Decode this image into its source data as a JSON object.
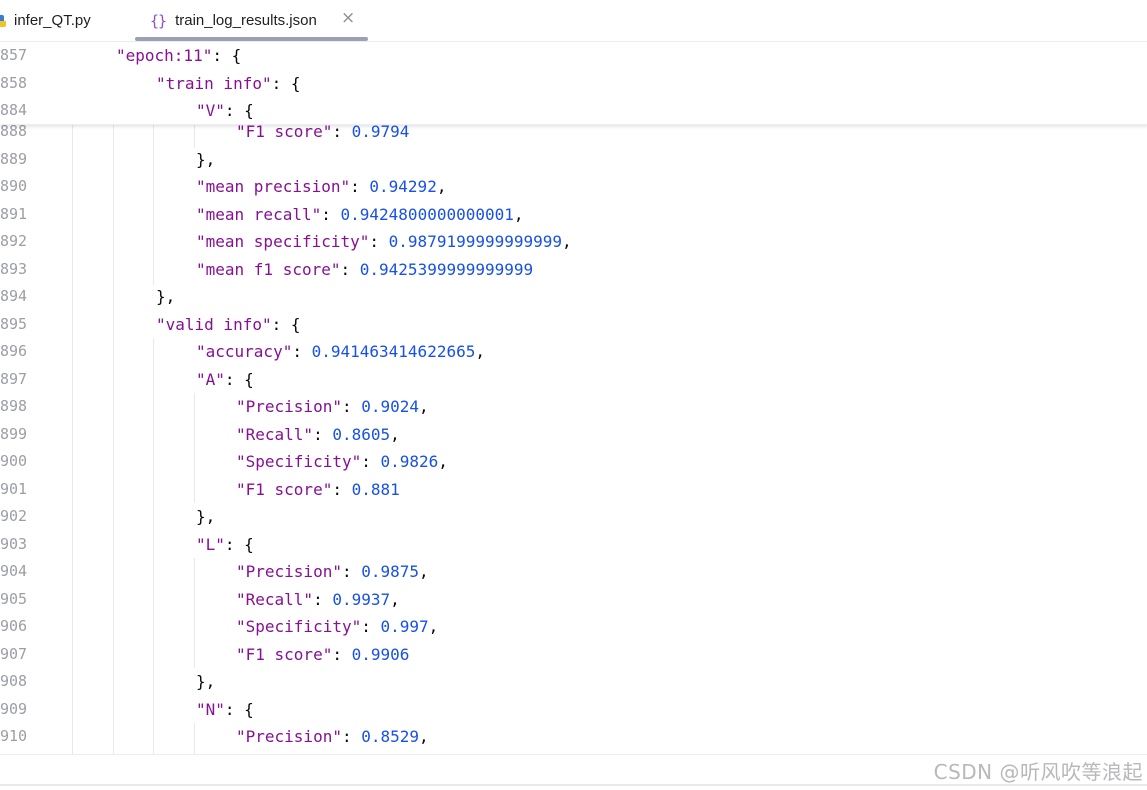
{
  "tabs": [
    {
      "label": "infer_QT.py",
      "icon": "python-file-icon",
      "active": false
    },
    {
      "label": "train_log_results.json",
      "icon": "json-file-icon",
      "glyph": "{}",
      "active": true
    }
  ],
  "close_glyph": "×",
  "sticky_lines": [
    {
      "num": "857",
      "indent": 1,
      "tokens": [
        {
          "t": "\"epoch:11\"",
          "c": "k"
        },
        {
          "t": ": {",
          "c": "p"
        }
      ]
    },
    {
      "num": "858",
      "indent": 2,
      "tokens": [
        {
          "t": "\"train info\"",
          "c": "k"
        },
        {
          "t": ": {",
          "c": "p"
        }
      ]
    },
    {
      "num": "884",
      "indent": 3,
      "tokens": [
        {
          "t": "\"V\"",
          "c": "k"
        },
        {
          "t": ": {",
          "c": "p"
        }
      ]
    }
  ],
  "lines": [
    {
      "num": "888",
      "indent": 4,
      "tokens": [
        {
          "t": "\"F1 score\"",
          "c": "k"
        },
        {
          "t": ": ",
          "c": "p"
        },
        {
          "t": "0.9794",
          "c": "n"
        }
      ]
    },
    {
      "num": "889",
      "indent": 3,
      "tokens": [
        {
          "t": "},",
          "c": "p"
        }
      ]
    },
    {
      "num": "890",
      "indent": 3,
      "tokens": [
        {
          "t": "\"mean precision\"",
          "c": "k"
        },
        {
          "t": ": ",
          "c": "p"
        },
        {
          "t": "0.94292",
          "c": "n"
        },
        {
          "t": ",",
          "c": "p"
        }
      ]
    },
    {
      "num": "891",
      "indent": 3,
      "tokens": [
        {
          "t": "\"mean recall\"",
          "c": "k"
        },
        {
          "t": ": ",
          "c": "p"
        },
        {
          "t": "0.9424800000000001",
          "c": "n"
        },
        {
          "t": ",",
          "c": "p"
        }
      ]
    },
    {
      "num": "892",
      "indent": 3,
      "tokens": [
        {
          "t": "\"mean specificity\"",
          "c": "k"
        },
        {
          "t": ": ",
          "c": "p"
        },
        {
          "t": "0.9879199999999999",
          "c": "n"
        },
        {
          "t": ",",
          "c": "p"
        }
      ]
    },
    {
      "num": "893",
      "indent": 3,
      "tokens": [
        {
          "t": "\"mean f1 score\"",
          "c": "k"
        },
        {
          "t": ": ",
          "c": "p"
        },
        {
          "t": "0.9425399999999999",
          "c": "n"
        }
      ]
    },
    {
      "num": "894",
      "indent": 2,
      "tokens": [
        {
          "t": "},",
          "c": "p"
        }
      ]
    },
    {
      "num": "895",
      "indent": 2,
      "tokens": [
        {
          "t": "\"valid info\"",
          "c": "k"
        },
        {
          "t": ": {",
          "c": "p"
        }
      ]
    },
    {
      "num": "896",
      "indent": 3,
      "tokens": [
        {
          "t": "\"accuracy\"",
          "c": "k"
        },
        {
          "t": ": ",
          "c": "p"
        },
        {
          "t": "0.941463414622665",
          "c": "n"
        },
        {
          "t": ",",
          "c": "p"
        }
      ]
    },
    {
      "num": "897",
      "indent": 3,
      "tokens": [
        {
          "t": "\"A\"",
          "c": "k"
        },
        {
          "t": ": {",
          "c": "p"
        }
      ]
    },
    {
      "num": "898",
      "indent": 4,
      "tokens": [
        {
          "t": "\"Precision\"",
          "c": "k"
        },
        {
          "t": ": ",
          "c": "p"
        },
        {
          "t": "0.9024",
          "c": "n"
        },
        {
          "t": ",",
          "c": "p"
        }
      ]
    },
    {
      "num": "899",
      "indent": 4,
      "tokens": [
        {
          "t": "\"Recall\"",
          "c": "k"
        },
        {
          "t": ": ",
          "c": "p"
        },
        {
          "t": "0.8605",
          "c": "n"
        },
        {
          "t": ",",
          "c": "p"
        }
      ]
    },
    {
      "num": "900",
      "indent": 4,
      "tokens": [
        {
          "t": "\"Specificity\"",
          "c": "k"
        },
        {
          "t": ": ",
          "c": "p"
        },
        {
          "t": "0.9826",
          "c": "n"
        },
        {
          "t": ",",
          "c": "p"
        }
      ]
    },
    {
      "num": "901",
      "indent": 4,
      "tokens": [
        {
          "t": "\"F1 score\"",
          "c": "k"
        },
        {
          "t": ": ",
          "c": "p"
        },
        {
          "t": "0.881",
          "c": "n"
        }
      ]
    },
    {
      "num": "902",
      "indent": 3,
      "tokens": [
        {
          "t": "},",
          "c": "p"
        }
      ]
    },
    {
      "num": "903",
      "indent": 3,
      "tokens": [
        {
          "t": "\"L\"",
          "c": "k"
        },
        {
          "t": ": {",
          "c": "p"
        }
      ]
    },
    {
      "num": "904",
      "indent": 4,
      "tokens": [
        {
          "t": "\"Precision\"",
          "c": "k"
        },
        {
          "t": ": ",
          "c": "p"
        },
        {
          "t": "0.9875",
          "c": "n"
        },
        {
          "t": ",",
          "c": "p"
        }
      ]
    },
    {
      "num": "905",
      "indent": 4,
      "tokens": [
        {
          "t": "\"Recall\"",
          "c": "k"
        },
        {
          "t": ": ",
          "c": "p"
        },
        {
          "t": "0.9937",
          "c": "n"
        },
        {
          "t": ",",
          "c": "p"
        }
      ]
    },
    {
      "num": "906",
      "indent": 4,
      "tokens": [
        {
          "t": "\"Specificity\"",
          "c": "k"
        },
        {
          "t": ": ",
          "c": "p"
        },
        {
          "t": "0.997",
          "c": "n"
        },
        {
          "t": ",",
          "c": "p"
        }
      ]
    },
    {
      "num": "907",
      "indent": 4,
      "tokens": [
        {
          "t": "\"F1 score\"",
          "c": "k"
        },
        {
          "t": ": ",
          "c": "p"
        },
        {
          "t": "0.9906",
          "c": "n"
        }
      ]
    },
    {
      "num": "908",
      "indent": 3,
      "tokens": [
        {
          "t": "},",
          "c": "p"
        }
      ]
    },
    {
      "num": "909",
      "indent": 3,
      "tokens": [
        {
          "t": "\"N\"",
          "c": "k"
        },
        {
          "t": ": {",
          "c": "p"
        }
      ]
    },
    {
      "num": "910",
      "indent": 4,
      "tokens": [
        {
          "t": "\"Precision\"",
          "c": "k"
        },
        {
          "t": ": ",
          "c": "p"
        },
        {
          "t": "0.8529",
          "c": "n"
        },
        {
          "t": ",",
          "c": "p"
        }
      ]
    }
  ],
  "watermark": "CSDN @听风吹等浪起",
  "colors": {
    "key": "#871094",
    "number": "#1750eb",
    "punct": "#080808",
    "gutter": "#9b9ea6"
  }
}
